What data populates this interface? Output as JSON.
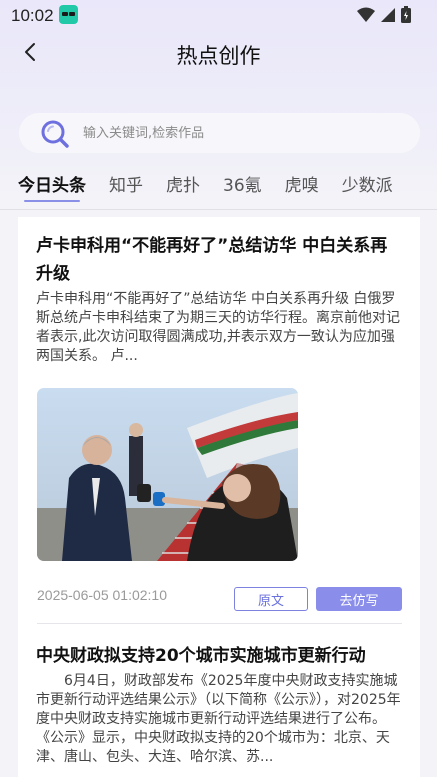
{
  "status_bar": {
    "time": "10:02",
    "icons": [
      "app-icon",
      "wifi-icon",
      "cellular-icon",
      "battery-icon"
    ]
  },
  "header": {
    "title": "热点创作",
    "back_icon": "chevron-left-icon"
  },
  "search": {
    "placeholder": "输入关键词,检索作品",
    "value": ""
  },
  "tabs": [
    {
      "label": "今日头条",
      "active": true
    },
    {
      "label": "知乎",
      "active": false
    },
    {
      "label": "虎扑",
      "active": false
    },
    {
      "label": "36氪",
      "active": false
    },
    {
      "label": "虎嗅",
      "active": false
    },
    {
      "label": "少数派",
      "active": false
    }
  ],
  "articles": [
    {
      "title": "卢卡申科用“不能再好了”总结访华 中白关系再升级",
      "summary": "卢卡申科用“不能再好了”总结访华 中白关系再升级 白俄罗斯总统卢卡申科结束了为期三天的访华行程。离京前他对记者表示,此次访问取得圆满成功,并表示双方一致认为应加强两国关系。 卢...",
      "has_image": true,
      "time": "2025-06-05 01:02:10",
      "original_label": "原文",
      "imitate_label": "去仿写"
    },
    {
      "title": "中央财政拟支持20个城市实施城市更新行动",
      "summary": "6月4日，财政部发布《2025年度中央财政支持实施城市更新行动评选结果公示》（以下简称《公示》），对2025年度中央财政支持实施城市更新行动评选结果进行了公布。　　《公示》显示，中央财政拟支持的20个城市为：北京、天津、唐山、包头、大连、哈尔滨、苏..."
    }
  ],
  "colors": {
    "accent": "#8a8eea",
    "accent_border": "#7d82e0",
    "background_top": "#e9e7f9",
    "card": "#ffffff"
  }
}
